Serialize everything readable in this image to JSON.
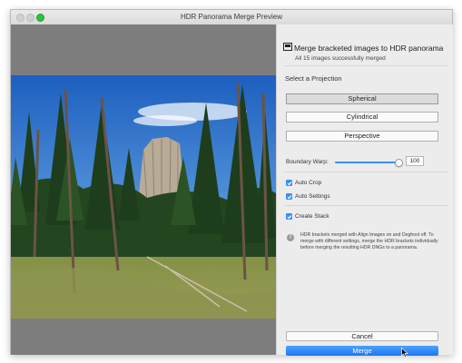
{
  "window": {
    "title": "HDR Panorama Merge Preview"
  },
  "header": {
    "title": "Merge bracketed images to HDR panorama",
    "subtitle": "All 15 images successfully merged"
  },
  "projection": {
    "label": "Select a Projection",
    "options": [
      "Spherical",
      "Cylindrical",
      "Perspective"
    ],
    "selected": "Spherical"
  },
  "boundary_warp": {
    "label": "Boundary Warp:",
    "value": "100",
    "fraction": 1.0
  },
  "options": {
    "auto_crop": {
      "label": "Auto Crop",
      "checked": true
    },
    "auto_settings": {
      "label": "Auto Settings",
      "checked": true
    },
    "create_stack": {
      "label": "Create Stack",
      "checked": true
    }
  },
  "info": {
    "text": "HDR brackets merged with Align Images on and Deghost off. To merge with different settings, merge the HDR brackets individually before merging the resulting HDR DNGs to a panorama."
  },
  "buttons": {
    "cancel": "Cancel",
    "merge": "Merge"
  },
  "colors": {
    "accent": "#3a8ef5",
    "merge_button": "#2a84f5"
  },
  "preview_image": {
    "subject": "Devils Tower framed by pine forest under blue sky"
  }
}
